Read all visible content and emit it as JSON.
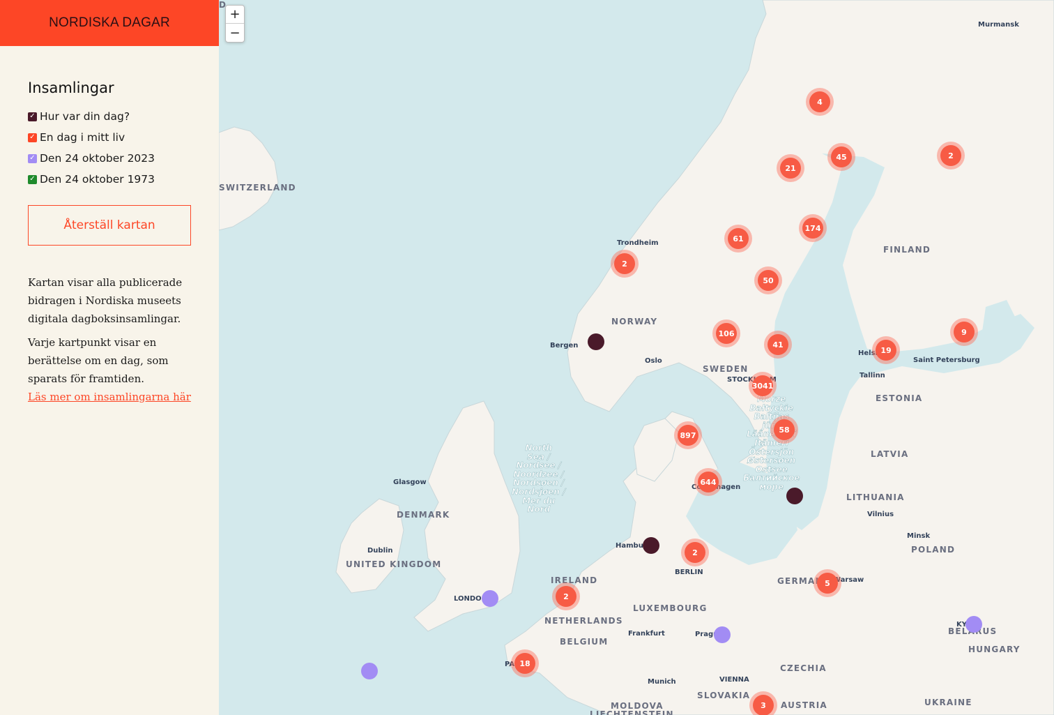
{
  "brand": {
    "title": "NORDISKA DAGAR"
  },
  "sidebar": {
    "heading": "Insamlingar",
    "filters": [
      {
        "label": "Hur var din dag?",
        "color": "#4a1a2a",
        "checked": true
      },
      {
        "label": "En dag i mitt liv",
        "color": "#fd4626",
        "checked": true
      },
      {
        "label": "Den 24 oktober 2023",
        "color": "#a28cf4",
        "checked": true
      },
      {
        "label": "Den 24 oktober 1973",
        "color": "#1f8a2c",
        "checked": true
      }
    ],
    "reset_label": "Återställ kartan",
    "description_1": "Kartan visar alla publicerade bidragen i Nordiska museets digitala dagboksinsamlingar.",
    "description_2": "Varje kartpunkt visar en berättelse om en dag, som sparats för framtiden.",
    "more_link": "Läs mer om insamlingarna här"
  },
  "map": {
    "zoom_in": "+",
    "zoom_out": "−",
    "colors": {
      "water": "#d3e9ec",
      "land": "#f6f3ee",
      "cluster": "#f75b45",
      "dot_dark": "#4a1a2a",
      "dot_purple": "#a28cf4"
    },
    "clusters": [
      "4",
      "45",
      "21",
      "2",
      "174",
      "61",
      "2",
      "50",
      "106",
      "41",
      "9",
      "19",
      "3041",
      "58",
      "897",
      "644",
      "2",
      "5",
      "2",
      "18",
      "3"
    ],
    "cities": [
      "Murmansk",
      "Trondheim",
      "Bergen",
      "Oslo",
      "STOCKHOLM",
      "Helsinki",
      "Saint Petersburg",
      "Tallinn",
      "Glasgow",
      "Copenhagen",
      "Dublin",
      "LONDON",
      "Hamburg",
      "BERLIN",
      "Warsaw",
      "Vilnius",
      "Minsk",
      "Frankfurt",
      "Prague",
      "Munich",
      "VIENNA",
      "PARIS",
      "KYIV"
    ],
    "countries": [
      "FINLAND",
      "NORWAY",
      "SWEDEN",
      "ESTONIA",
      "LATVIA",
      "LITHUANIA",
      "DENMARK",
      "UNITED KINGDOM",
      "IRELAND",
      "NETHERLANDS",
      "BELGIUM",
      "LUXEMBOURG",
      "GERMANY",
      "POLAND",
      "BELARUS",
      "CZECHIA",
      "SLOVAKIA",
      "AUSTRIA",
      "HUNGARY",
      "UKRAINE",
      "MOLDOVA",
      "LIECHTENSTEIN",
      "SWITZERLAND",
      "D"
    ],
    "seas": {
      "north_sea": "North\nSea /\nNordsee /\nNoordzee /\nNordsøen /\nNordsjøen /\nMer du\nNord",
      "baltic_sea": "Morze\nBałtyckie\nBaltijas\njūra\nLäänemeri\nItämeri\nÖstersjön\nØstersøen\nOstsee\nБалтийское\nморе"
    }
  }
}
